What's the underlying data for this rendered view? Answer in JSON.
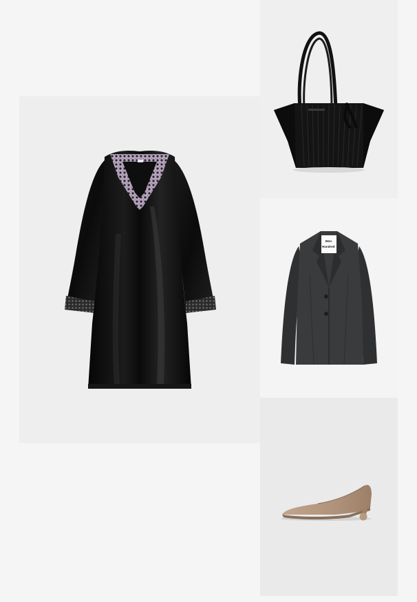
{
  "board": {
    "background": "#f5f5f5"
  },
  "items": [
    {
      "id": "dress",
      "kind": "black satin lace-trim dress",
      "tile_color": "#eeeeee",
      "item_color": "#0d0d0d",
      "accent_color": "#b6a5bc"
    },
    {
      "id": "bag",
      "kind": "black pleated tote bag",
      "tile_color": "#efefef",
      "item_color": "#141414"
    },
    {
      "id": "blazer",
      "kind": "charcoal single-breasted blazer",
      "tile_color": "#f4f4f4",
      "item_color": "#3a3b3d",
      "label_lines": [
        "Won",
        "Hundred"
      ]
    },
    {
      "id": "shoe",
      "kind": "beige kitten-heel pump",
      "tile_color": "#eaeaea",
      "item_color": "#b89a80"
    }
  ]
}
